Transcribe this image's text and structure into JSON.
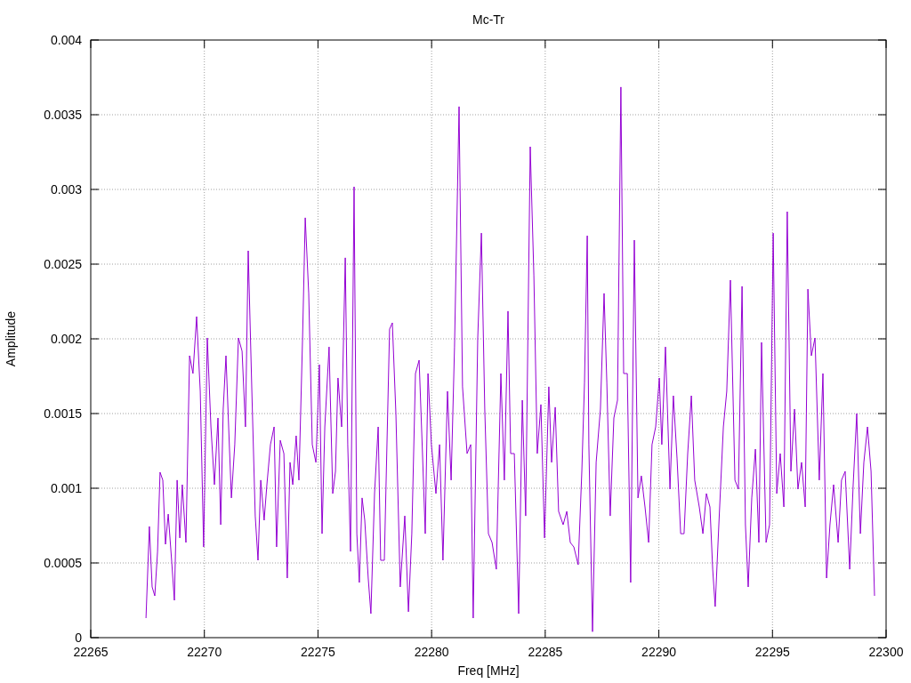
{
  "chart_data": {
    "type": "line",
    "title": "Mc-Tr",
    "grid": true,
    "xlabel": "Freq [MHz]",
    "ylabel": "Amplitude",
    "xlim": [
      22265,
      22300
    ],
    "ylim": [
      0,
      0.004
    ],
    "xticks": [
      22265,
      22270,
      22275,
      22280,
      22285,
      22290,
      22295,
      22300
    ],
    "yticks": [
      0,
      0.0005,
      0.001,
      0.0015,
      0.002,
      0.0025,
      0.003,
      0.0035,
      0.004
    ],
    "x": [
      22267.43,
      22267.58,
      22267.7,
      22267.82,
      22267.94,
      22268.05,
      22268.17,
      22268.29,
      22268.41,
      22268.56,
      22268.68,
      22268.8,
      22268.92,
      22269.03,
      22269.19,
      22269.35,
      22269.5,
      22269.66,
      22269.82,
      22269.97,
      22270.13,
      22270.29,
      22270.44,
      22270.6,
      22270.72,
      22270.83,
      22270.95,
      22271.07,
      22271.19,
      22271.34,
      22271.5,
      22271.66,
      22271.81,
      22271.93,
      22272.09,
      22272.24,
      22272.36,
      22272.48,
      22272.63,
      22272.75,
      22272.91,
      22273.07,
      22273.18,
      22273.34,
      22273.5,
      22273.65,
      22273.77,
      22273.89,
      22274.04,
      22274.16,
      22274.32,
      22274.44,
      22274.59,
      22274.75,
      22274.91,
      22275.06,
      22275.18,
      22275.3,
      22275.49,
      22275.65,
      22275.77,
      22275.88,
      22276.04,
      22276.2,
      22276.31,
      22276.43,
      22276.59,
      22276.71,
      22276.82,
      22276.94,
      22277.06,
      22277.21,
      22277.33,
      22277.49,
      22277.65,
      22277.76,
      22277.92,
      22278.15,
      22278.27,
      22278.43,
      22278.62,
      22278.82,
      22278.98,
      22279.13,
      22279.29,
      22279.45,
      22279.6,
      22279.72,
      22279.84,
      22279.99,
      22280.19,
      22280.35,
      22280.5,
      22280.7,
      22280.86,
      22281.01,
      22281.21,
      22281.36,
      22281.56,
      22281.72,
      22281.83,
      22282.03,
      22282.19,
      22282.34,
      22282.5,
      22282.66,
      22282.85,
      22283.05,
      22283.2,
      22283.36,
      22283.48,
      22283.64,
      22283.83,
      22283.99,
      22284.14,
      22284.34,
      22284.5,
      22284.65,
      22284.81,
      22284.97,
      22285.16,
      22285.28,
      22285.44,
      22285.59,
      22285.79,
      22285.95,
      22286.1,
      22286.26,
      22286.45,
      22286.61,
      22286.73,
      22286.85,
      22286.92,
      22287.08,
      22287.24,
      22287.43,
      22287.59,
      22287.71,
      22287.86,
      22288.02,
      22288.18,
      22288.33,
      22288.45,
      22288.61,
      22288.76,
      22288.92,
      22289.08,
      22289.23,
      22289.39,
      22289.55,
      22289.7,
      22289.86,
      22290.02,
      22290.13,
      22290.29,
      22290.49,
      22290.64,
      22290.8,
      22290.96,
      22291.11,
      22291.27,
      22291.43,
      22291.58,
      22291.78,
      22291.94,
      22292.09,
      22292.25,
      22292.37,
      22292.48,
      22292.64,
      22292.84,
      22292.99,
      22293.15,
      22293.35,
      22293.5,
      22293.66,
      22293.81,
      22293.93,
      22294.09,
      22294.25,
      22294.4,
      22294.52,
      22294.72,
      22294.87,
      22295.03,
      22295.19,
      22295.34,
      22295.5,
      22295.65,
      22295.81,
      22295.97,
      22296.12,
      22296.28,
      22296.44,
      22296.56,
      22296.71,
      22296.87,
      22297.06,
      22297.22,
      22297.38,
      22297.53,
      22297.69,
      22297.89,
      22298.04,
      22298.2,
      22298.4,
      22298.55,
      22298.71,
      22298.87,
      22299.02,
      22299.18,
      22299.34,
      22299.49
    ],
    "series": [
      {
        "color": "#9400d3",
        "values": [
          0.000131,
          0.000744,
          0.000339,
          0.00028,
          0.000577,
          0.001107,
          0.001054,
          0.000625,
          0.000827,
          0.000518,
          0.00025,
          0.001054,
          0.000667,
          0.001024,
          0.000637,
          0.001887,
          0.001768,
          0.002149,
          0.001649,
          0.000607,
          0.002006,
          0.001411,
          0.001024,
          0.00147,
          0.000756,
          0.00153,
          0.001887,
          0.001411,
          0.000935,
          0.001292,
          0.002006,
          0.001917,
          0.001411,
          0.002589,
          0.001649,
          0.000815,
          0.000518,
          0.001054,
          0.000786,
          0.001024,
          0.001292,
          0.001411,
          0.000607,
          0.001321,
          0.001232,
          0.000399,
          0.001173,
          0.001024,
          0.001351,
          0.001054,
          0.002006,
          0.00281,
          0.002304,
          0.001292,
          0.001173,
          0.001827,
          0.000696,
          0.001411,
          0.001946,
          0.000964,
          0.001113,
          0.001738,
          0.001411,
          0.002542,
          0.001292,
          0.000577,
          0.003018,
          0.000696,
          0.000369,
          0.000935,
          0.000786,
          0.000399,
          0.000161,
          0.000964,
          0.001411,
          0.000518,
          0.000518,
          0.002065,
          0.002107,
          0.0015,
          0.000339,
          0.000815,
          0.000173,
          0.000696,
          0.001768,
          0.001857,
          0.001232,
          0.000696,
          0.001768,
          0.001292,
          0.000964,
          0.001292,
          0.000518,
          0.001649,
          0.001054,
          0.001946,
          0.003554,
          0.001679,
          0.001232,
          0.001292,
          0.000131,
          0.002006,
          0.002708,
          0.00153,
          0.000696,
          0.000637,
          0.000458,
          0.001768,
          0.001054,
          0.002185,
          0.001232,
          0.001232,
          0.000161,
          0.001589,
          0.000815,
          0.003286,
          0.002423,
          0.001232,
          0.00156,
          0.000667,
          0.001679,
          0.001173,
          0.001542,
          0.000845,
          0.000756,
          0.000845,
          0.000637,
          0.000607,
          0.000488,
          0.001113,
          0.001708,
          0.00269,
          0.001292,
          4e-05,
          0.001173,
          0.00153,
          0.002304,
          0.001708,
          0.000815,
          0.00147,
          0.001589,
          0.003685,
          0.001768,
          0.001768,
          0.000369,
          0.002661,
          0.000935,
          0.001083,
          0.000875,
          0.000637,
          0.001292,
          0.001411,
          0.001738,
          0.001292,
          0.001946,
          0.000994,
          0.001619,
          0.001202,
          0.000696,
          0.000696,
          0.001232,
          0.001619,
          0.001054,
          0.000875,
          0.000696,
          0.000964,
          0.000875,
          0.000458,
          0.000208,
          0.000756,
          0.001411,
          0.001649,
          0.002393,
          0.001054,
          0.000994,
          0.002351,
          0.000756,
          0.000339,
          0.000935,
          0.001262,
          0.000637,
          0.001976,
          0.000637,
          0.000756,
          0.002708,
          0.000964,
          0.001232,
          0.000875,
          0.002851,
          0.001113,
          0.00153,
          0.000994,
          0.001173,
          0.000875,
          0.002333,
          0.001887,
          0.002006,
          0.001054,
          0.001768,
          0.000399,
          0.000756,
          0.001024,
          0.000637,
          0.001054,
          0.001113,
          0.000458,
          0.001024,
          0.0015,
          0.000696,
          0.001173,
          0.001411,
          0.001113,
          0.00028
        ]
      }
    ]
  }
}
